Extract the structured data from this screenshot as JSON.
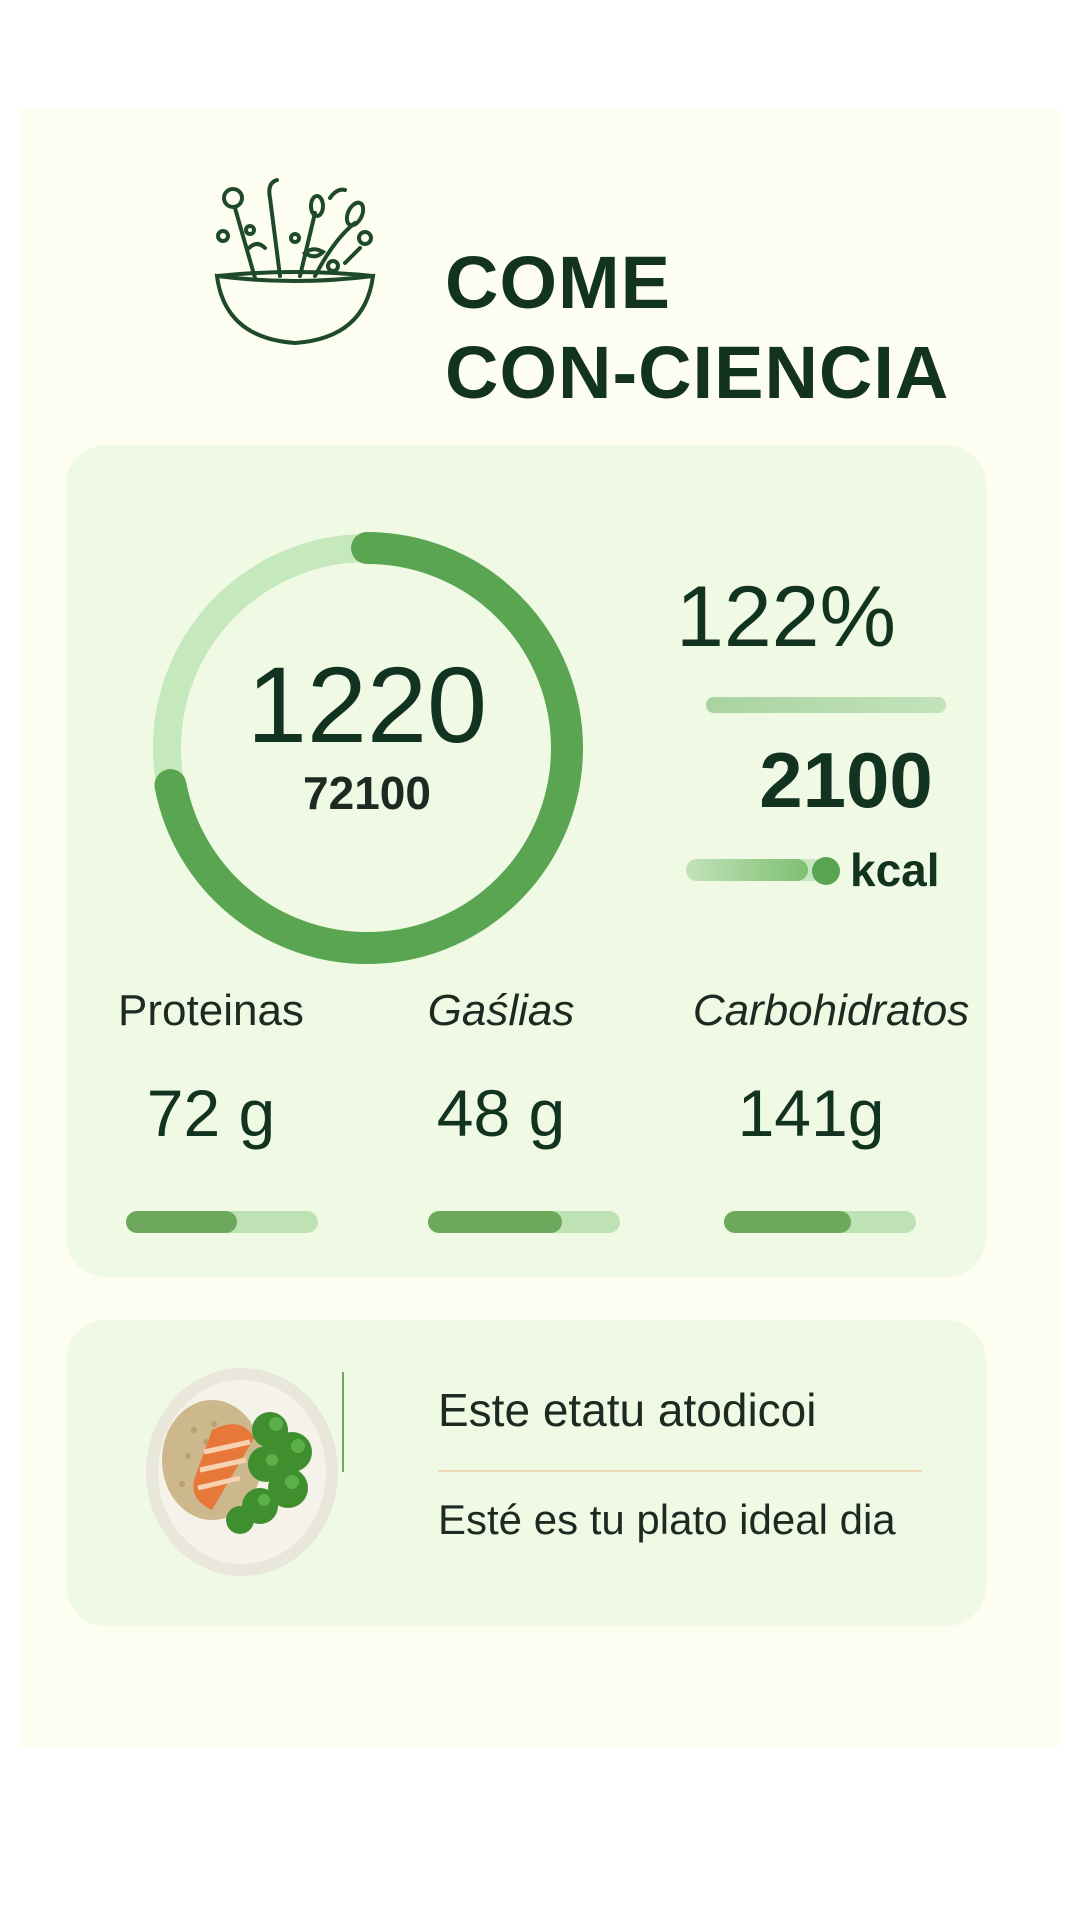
{
  "app": {
    "title_line1": "COME",
    "title_line2": "CON-CIENCIA",
    "logo_icon": "salad-bowl-icon"
  },
  "summary": {
    "ring_value": "1220",
    "ring_subtext": "72100",
    "ring_progress": 0.72,
    "percent_text": "122%",
    "percent_bar_fill": 1.0,
    "goal_value": "2100",
    "goal_unit": "kcal",
    "kcal_bar_fill": 0.85
  },
  "macros": [
    {
      "label": "Proteinas",
      "value": "72 g",
      "fill": 0.58
    },
    {
      "label": "Gaślias",
      "value": "48 g",
      "fill": 0.7
    },
    {
      "label": "Carbohidratos",
      "value": "141g",
      "fill": 0.66
    }
  ],
  "meal": {
    "title": "Este etatu atodicoi",
    "subtitle": "Esté es tu plato ideal dia",
    "image_icon": "meal-plate-image"
  },
  "colors": {
    "accent": "#5aa551",
    "accent_light": "#c3e6bb",
    "card_bg": "#eff9e4",
    "text_dark": "#123320"
  }
}
